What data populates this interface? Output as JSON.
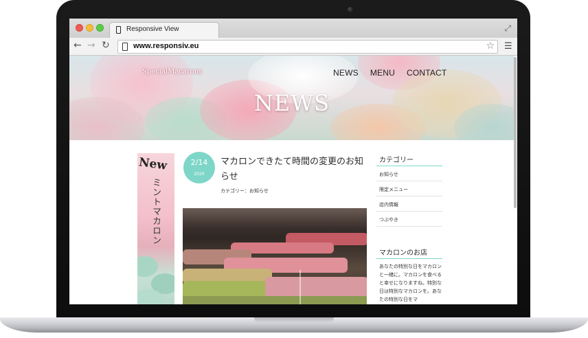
{
  "browser": {
    "tab_title": "Responsive View",
    "url": "www.responsiv.eu"
  },
  "site": {
    "logo": "SpecialMacarons",
    "nav": [
      "NEWS",
      "MENU",
      "CONTACT"
    ],
    "hero_title": "NEWS"
  },
  "banner": {
    "new_label": "New",
    "text": "ミントマカロン"
  },
  "post": {
    "date_day": "2/14",
    "date_year": "2020",
    "title": "マカロンできたて時間の変更のお知らせ",
    "category": "カテゴリー：お知らせ"
  },
  "sidebar": {
    "category_heading": "カテゴリー",
    "categories": [
      "お知らせ",
      "限定メニュー",
      "店内情報",
      "つぶやき"
    ],
    "shop_heading": "マカロンのお店",
    "shop_text": "あなたの特別な日をマカロンと一緒に。マカロンを食べると幸せになりますね。特別な日は特別なマカロンを。あなたの特別な日をマ"
  },
  "colors": {
    "accent": "#7ed6c8",
    "traffic_red": "#ee5c54",
    "traffic_yellow": "#f6bd3a",
    "traffic_green": "#5dcc48"
  }
}
